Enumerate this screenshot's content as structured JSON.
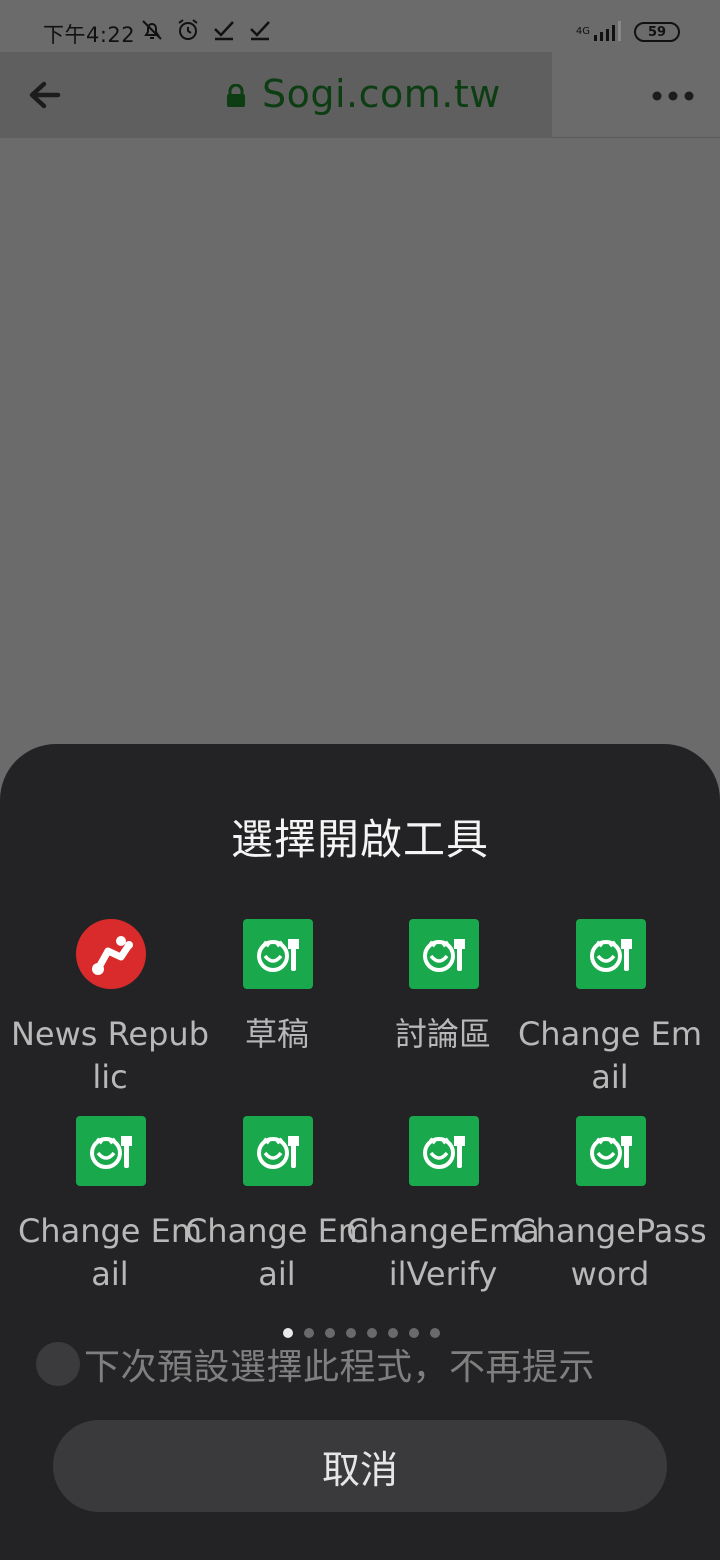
{
  "status_bar": {
    "time": "下午4:22",
    "icons": [
      "mute-icon",
      "alarm-icon",
      "check-icon",
      "check-icon"
    ],
    "network": "4G",
    "battery": "59"
  },
  "toolbar": {
    "url": "Sogi.com.tw",
    "url_color": "#0d3d12"
  },
  "sheet": {
    "title": "選擇開啟工具",
    "apps": [
      {
        "label": "News Republic",
        "icon": "news-republic-icon",
        "color": "#d92b2b"
      },
      {
        "label": "草稿",
        "icon": "sogi-app-icon",
        "color": "#1aa84d"
      },
      {
        "label": "討論區",
        "icon": "sogi-app-icon",
        "color": "#1aa84d"
      },
      {
        "label": "Change Email",
        "icon": "sogi-app-icon",
        "color": "#1aa84d"
      },
      {
        "label": "Change Email",
        "icon": "sogi-app-icon",
        "color": "#1aa84d"
      },
      {
        "label": "Change Email",
        "icon": "sogi-app-icon",
        "color": "#1aa84d"
      },
      {
        "label": "ChangeEmailVerify",
        "icon": "sogi-app-icon",
        "color": "#1aa84d"
      },
      {
        "label": "ChangePassword",
        "icon": "sogi-app-icon",
        "color": "#1aa84d"
      }
    ],
    "page_count": 8,
    "current_page": 1,
    "remember_label": "下次預設選擇此程式，不再提示",
    "cancel_label": "取消"
  }
}
